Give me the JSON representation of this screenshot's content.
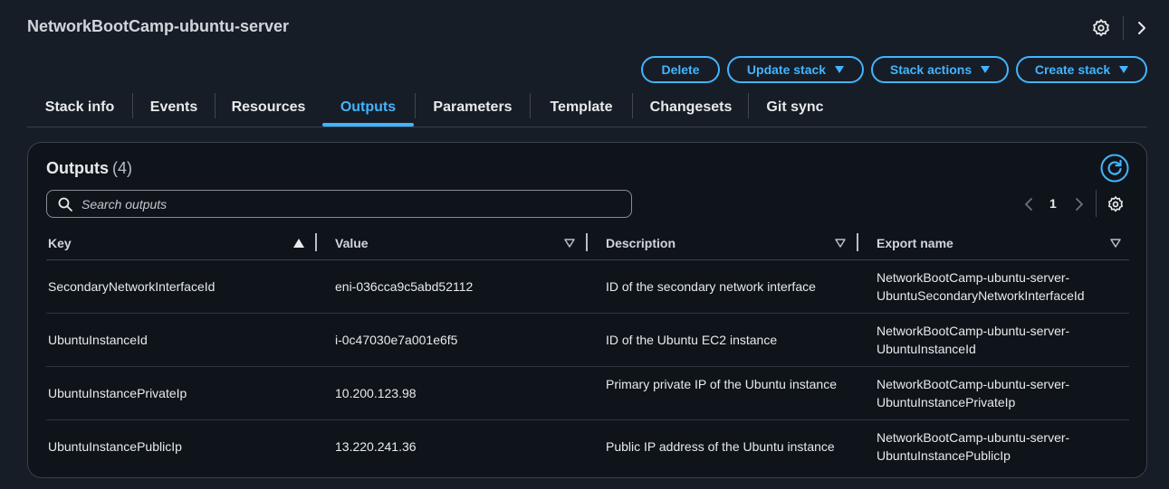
{
  "stack": {
    "title": "NetworkBootCamp-ubuntu-server"
  },
  "icons": {
    "header_settings": "gear-icon",
    "header_next": "chevron-right-icon",
    "refresh": "refresh-icon",
    "search": "search-icon"
  },
  "colors": {
    "accent": "#42b4ff",
    "background": "#161d26",
    "panel": "#0f141a"
  },
  "actions": {
    "delete": "Delete",
    "update": "Update stack",
    "stack_actions": "Stack actions",
    "create": "Create stack"
  },
  "tabs": [
    {
      "label": "Stack info"
    },
    {
      "label": "Events"
    },
    {
      "label": "Resources"
    },
    {
      "label": "Outputs",
      "active": true
    },
    {
      "label": "Parameters"
    },
    {
      "label": "Template"
    },
    {
      "label": "Changesets"
    },
    {
      "label": "Git sync"
    }
  ],
  "outputs": {
    "title": "Outputs",
    "count": "(4)",
    "search_placeholder": "Search outputs",
    "page": "1",
    "columns": {
      "key": "Key",
      "value": "Value",
      "description": "Description",
      "export": "Export name"
    },
    "rows": [
      {
        "key": "SecondaryNetworkInterfaceId",
        "value": "eni-036cca9c5abd52112",
        "description": "ID of the secondary network interface",
        "export_line1": "NetworkBootCamp-ubuntu-server-",
        "export_line2": "UbuntuSecondaryNetworkInterfaceId"
      },
      {
        "key": "UbuntuInstanceId",
        "value": "i-0c47030e7a001e6f5",
        "description": "ID of the Ubuntu EC2 instance",
        "export_line1": "NetworkBootCamp-ubuntu-server-",
        "export_line2": "UbuntuInstanceId"
      },
      {
        "key": "UbuntuInstancePrivateIp",
        "value": "10.200.123.98",
        "description": "Primary private IP of the Ubuntu instance",
        "export_line1": "NetworkBootCamp-ubuntu-server-",
        "export_line2": "UbuntuInstancePrivateIp"
      },
      {
        "key": "UbuntuInstancePublicIp",
        "value": "13.220.241.36",
        "description": "Public IP address of the Ubuntu instance",
        "export_line1": "NetworkBootCamp-ubuntu-server-",
        "export_line2": "UbuntuInstancePublicIp"
      }
    ]
  }
}
